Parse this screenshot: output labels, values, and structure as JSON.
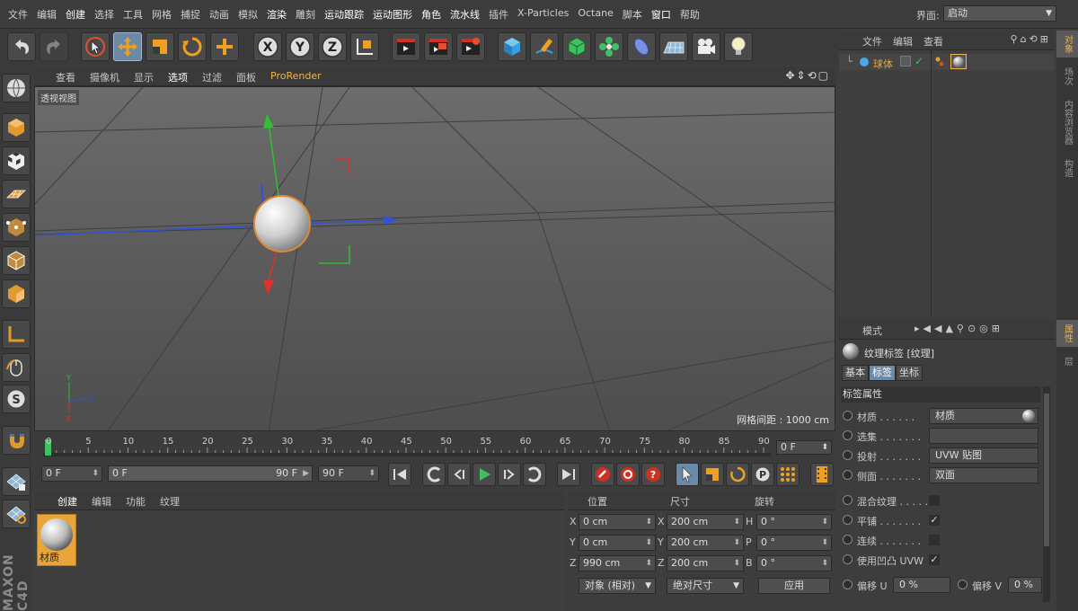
{
  "menubar": {
    "items": [
      "文件",
      "编辑",
      "创建",
      "选择",
      "工具",
      "网格",
      "捕捉",
      "动画",
      "模拟",
      "渲染",
      "雕刻",
      "运动跟踪",
      "运动图形",
      "角色",
      "流水线",
      "插件",
      "X-Particles",
      "Octane",
      "脚本",
      "窗口",
      "帮助"
    ],
    "layout_label": "界面:",
    "layout_value": "启动"
  },
  "viewport": {
    "menu": [
      "查看",
      "摄像机",
      "显示",
      "选项",
      "过滤",
      "面板",
      "ProRender"
    ],
    "view_name": "透视视图",
    "grid_spacing_label": "网格间距 : 1000 cm"
  },
  "timeline": {
    "ticks": [
      "0",
      "5",
      "10",
      "15",
      "20",
      "25",
      "30",
      "35",
      "40",
      "45",
      "50",
      "55",
      "60",
      "65",
      "70",
      "75",
      "80",
      "85",
      "90"
    ],
    "current_frame": "0 F",
    "start_frame": "0 F",
    "range_start": "0 F",
    "range_end": "90 F",
    "end_frame": "90 F"
  },
  "material_manager": {
    "menu": [
      "创建",
      "编辑",
      "功能",
      "纹理"
    ],
    "material_name": "材质"
  },
  "coordinates": {
    "headers": {
      "position": "位置",
      "size": "尺寸",
      "rotation": "旋转"
    },
    "rows": [
      {
        "axis": "X",
        "pos": "0 cm",
        "size_axis": "X",
        "size": "200 cm",
        "rot_axis": "H",
        "rot": "0 °"
      },
      {
        "axis": "Y",
        "pos": "0 cm",
        "size_axis": "Y",
        "size": "200 cm",
        "rot_axis": "P",
        "rot": "0 °"
      },
      {
        "axis": "Z",
        "pos": "990 cm",
        "size_axis": "Z",
        "size": "200 cm",
        "rot_axis": "B",
        "rot": "0 °"
      }
    ],
    "mode": "对象 (相对)",
    "size_mode": "绝对尺寸",
    "apply_label": "应用"
  },
  "object_manager": {
    "menu": [
      "文件",
      "编辑",
      "查看"
    ],
    "object_name": "球体"
  },
  "right_tabs": [
    "对象",
    "场次",
    "内容浏览器",
    "构造",
    "属性",
    "层"
  ],
  "attributes": {
    "mode_label": "模式",
    "title": "纹理标签 [纹理]",
    "tabs": [
      "基本",
      "标签",
      "坐标"
    ],
    "section": "标签属性",
    "rows": {
      "material": {
        "label": "材质 . . . . . .",
        "value": "材质"
      },
      "selection": {
        "label": "选集 . . . . . . .",
        "value": ""
      },
      "projection": {
        "label": "投射 . . . . . . .",
        "value": "UVW 贴图"
      },
      "side": {
        "label": "侧面 . . . . . . .",
        "value": "双面"
      },
      "mix": {
        "label": "混合纹理 . . . . .",
        "value": ""
      },
      "tile": {
        "label": "平铺 . . . . . . .",
        "value": "✓"
      },
      "seamless": {
        "label": "连续 . . . . . . .",
        "value": ""
      },
      "bump_uvw": {
        "label": "使用凹凸 UVW",
        "value": "✓"
      },
      "offset_u": {
        "label": "偏移 U",
        "value": "0 %"
      },
      "offset_v": {
        "label": "偏移 V",
        "value": "0 %"
      }
    }
  },
  "colors": {
    "accent": "#f0b44a",
    "selected": "#6b8aa8",
    "x_axis": "#e03030",
    "y_axis": "#30c030",
    "z_axis": "#3050e0"
  }
}
